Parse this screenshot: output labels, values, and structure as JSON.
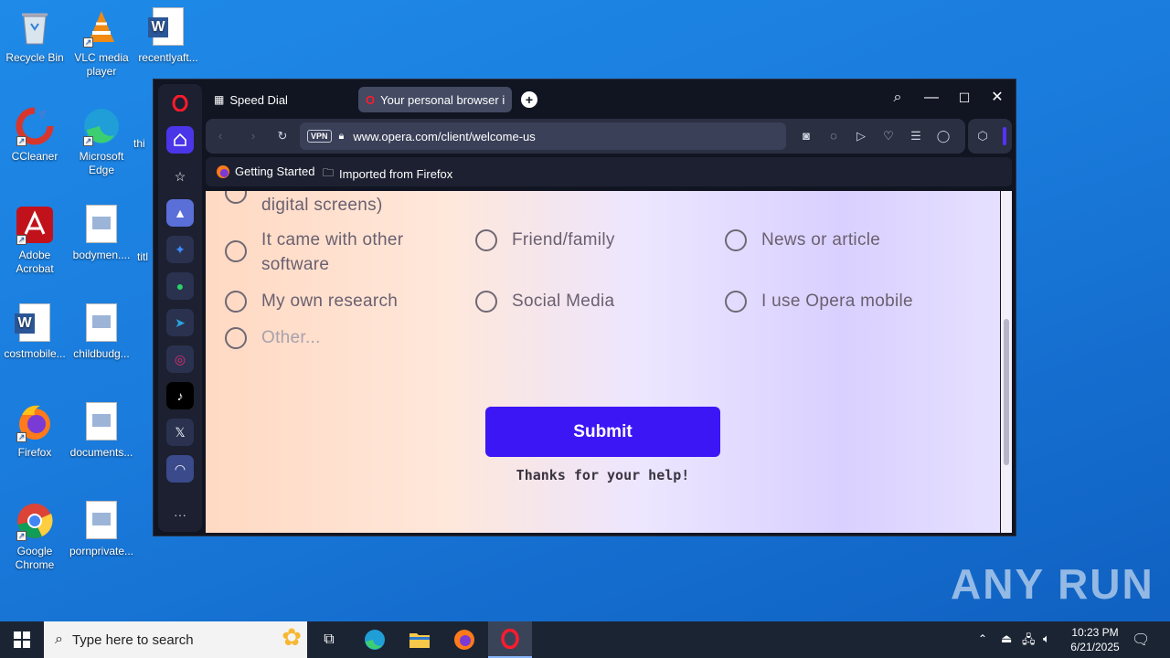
{
  "desktop": {
    "icons": [
      {
        "label": "Recycle Bin"
      },
      {
        "label": "VLC media player"
      },
      {
        "label": "recentlyaft..."
      },
      {
        "label": "CCleaner"
      },
      {
        "label": "Microsoft Edge"
      },
      {
        "label": "thi"
      },
      {
        "label": "Adobe Acrobat"
      },
      {
        "label": "bodymen...."
      },
      {
        "label": "titl"
      },
      {
        "label": "costmobile..."
      },
      {
        "label": "childbudg..."
      },
      {
        "label": "Firefox"
      },
      {
        "label": "documents..."
      },
      {
        "label": "Google Chrome"
      },
      {
        "label": "pornprivate..."
      }
    ],
    "watermark": "ANY RUN"
  },
  "browser": {
    "tabs": [
      {
        "label": "Speed Dial",
        "icon": "grid-icon"
      },
      {
        "label": "Your personal browser is a",
        "icon": "opera-icon"
      }
    ],
    "address": {
      "vpn": "VPN",
      "url": "www.opera.com/client/welcome-us"
    },
    "bookmarks": [
      {
        "label": "Getting Started",
        "icon": "firefox-icon"
      },
      {
        "label": "Imported from Firefox",
        "icon": "folder-icon"
      }
    ],
    "sidebar_more": "···"
  },
  "page": {
    "partial_option": "digital screens)",
    "options": [
      {
        "label": "It came with other software"
      },
      {
        "label": "Friend/family"
      },
      {
        "label": "News or article"
      },
      {
        "label": "My own research"
      },
      {
        "label": "Social Media"
      },
      {
        "label": "I use Opera mobile"
      },
      {
        "label": "Other..."
      }
    ],
    "submit_label": "Submit",
    "thanks_text": "Thanks for your help!",
    "colors": {
      "accent": "#3d16f5"
    }
  },
  "taskbar": {
    "search_placeholder": "Type here to search",
    "time": "10:23 PM",
    "date": "6/21/2025"
  }
}
